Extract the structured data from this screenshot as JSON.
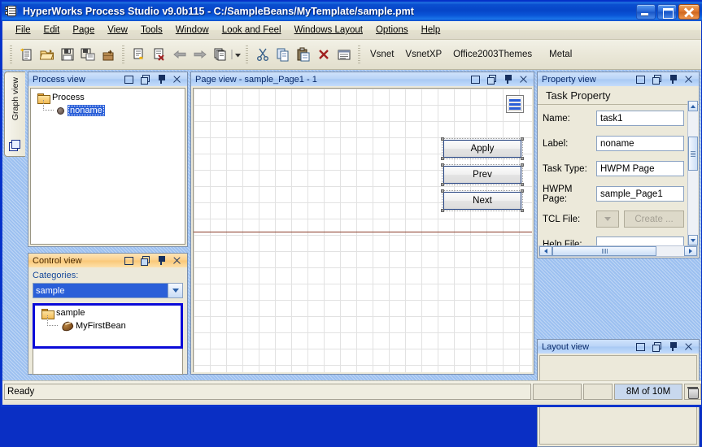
{
  "window": {
    "title": "HyperWorks Process Studio v9.0b115 - C:/SampleBeans/MyTemplate/sample.pmt",
    "icon": "application-icon",
    "minimize_label": "Minimize",
    "maximize_label": "Maximize",
    "close_label": "Close"
  },
  "menubar": {
    "items": [
      {
        "label": "File"
      },
      {
        "label": "Edit"
      },
      {
        "label": "Page"
      },
      {
        "label": "View"
      },
      {
        "label": "Tools"
      },
      {
        "label": "Window"
      },
      {
        "label": "Look and Feel"
      },
      {
        "label": "Windows Layout"
      },
      {
        "label": "Options"
      },
      {
        "label": "Help"
      }
    ]
  },
  "toolbar": {
    "buttons": [
      {
        "icon": "new-document-icon",
        "tooltip": "New"
      },
      {
        "icon": "open-folder-icon",
        "tooltip": "Open"
      },
      {
        "icon": "save-floppy-icon",
        "tooltip": "Save"
      },
      {
        "icon": "save-as-floppy-icon",
        "tooltip": "Save As"
      },
      {
        "icon": "export-box-icon",
        "tooltip": "Export"
      },
      {
        "icon": "new-page-icon",
        "tooltip": "New Page"
      },
      {
        "icon": "delete-page-icon",
        "tooltip": "Delete Page"
      },
      {
        "icon": "arrow-left-icon",
        "tooltip": "Previous"
      },
      {
        "icon": "arrow-right-icon",
        "tooltip": "Next"
      },
      {
        "icon": "pages-stack-icon",
        "tooltip": "Pages"
      },
      {
        "icon": "dropdown-arrow-icon",
        "tooltip": "More"
      },
      {
        "icon": "cut-scissors-icon",
        "tooltip": "Cut"
      },
      {
        "icon": "copy-icon",
        "tooltip": "Copy"
      },
      {
        "icon": "paste-clipboard-icon",
        "tooltip": "Paste"
      },
      {
        "icon": "delete-x-icon",
        "tooltip": "Delete"
      },
      {
        "icon": "properties-list-icon",
        "tooltip": "Properties"
      }
    ],
    "themes": [
      "Vsnet",
      "VsnetXP",
      "Office2003Themes",
      "Metal"
    ]
  },
  "vertical_tab": {
    "label": "Graph view",
    "icon": "graph-cube-icon"
  },
  "panels": {
    "process_view": {
      "title": "Process view",
      "controls": [
        "restore-small-icon",
        "restore-double-icon",
        "pin-icon",
        "close-icon"
      ],
      "tree": {
        "root": {
          "label": "Process",
          "icon": "folder-icon"
        },
        "children": [
          {
            "label": "noname",
            "icon": "node-dot-icon",
            "selected": true
          }
        ]
      }
    },
    "control_view": {
      "title": "Control view",
      "controls": [
        "restore-small-icon",
        "restore-double-icon",
        "pin-icon",
        "close-icon"
      ],
      "categories_label": "Categories:",
      "categories_value": "sample",
      "categories_options": [
        "sample"
      ],
      "tree": {
        "root": {
          "label": "sample",
          "icon": "folder-icon"
        },
        "children": [
          {
            "label": "MyFirstBean",
            "icon": "bean-icon"
          }
        ]
      },
      "highlight_color": "#0b0bd8"
    },
    "page_view": {
      "title": "Page view - sample_Page1 - 1",
      "controls": [
        "restore-small-icon",
        "restore-double-icon",
        "pin-icon",
        "close-icon"
      ],
      "widgets": [
        {
          "name": "menu-widget",
          "type": "menu",
          "label": ""
        },
        {
          "name": "apply-button",
          "type": "button",
          "label": "Apply"
        },
        {
          "name": "prev-button",
          "type": "button",
          "label": "Prev"
        },
        {
          "name": "next-button",
          "type": "button",
          "label": "Next"
        }
      ],
      "separator_color": "#8a3a28"
    },
    "property_view": {
      "title": "Property view",
      "controls": [
        "restore-small-icon",
        "restore-double-icon",
        "pin-icon",
        "close-icon"
      ],
      "heading": "Task Property",
      "rows": [
        {
          "label": "Name:",
          "value": "task1",
          "type": "text",
          "enabled": true
        },
        {
          "label": "Label:",
          "value": "noname",
          "type": "text",
          "enabled": true
        },
        {
          "label": "Task Type:",
          "value": "HWPM Page",
          "type": "text",
          "enabled": true
        },
        {
          "label": "HWPM Page:",
          "value": "sample_Page1",
          "type": "text",
          "enabled": true
        },
        {
          "label": "TCL File:",
          "value": "",
          "type": "combo-button",
          "button_label": "Create ...",
          "enabled": false
        },
        {
          "label": "Help File:",
          "value": "",
          "type": "text",
          "enabled": true
        }
      ]
    },
    "layout_view": {
      "title": "Layout view",
      "controls": [
        "restore-small-icon",
        "restore-double-icon",
        "pin-icon",
        "close-icon"
      ]
    }
  },
  "statusbar": {
    "message": "Ready",
    "field_blank_1": "",
    "field_blank_2": "",
    "memory": "8M of 10M",
    "trash_icon": "trash-icon"
  }
}
